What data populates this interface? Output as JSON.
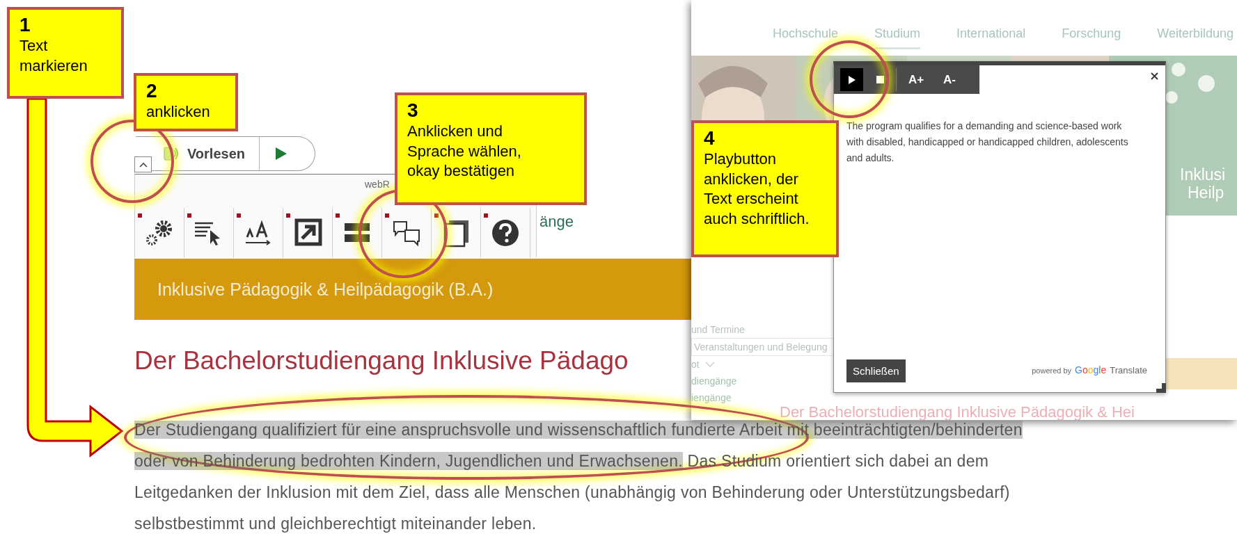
{
  "callouts": [
    {
      "number": "1",
      "text": "Text markieren"
    },
    {
      "number": "2",
      "text": "anklicken"
    },
    {
      "number": "3",
      "text": "Anklicken und Sprache wählen, okay bestätigen"
    },
    {
      "number": "4",
      "text": "Playbutton anklicken, der Text erscheint auch schriftlich."
    }
  ],
  "reader_bar": {
    "label": "Vorlesen"
  },
  "tool_panel": {
    "title": "webR",
    "trailing_text": "änge"
  },
  "course_banner": {
    "title": "Inklusive Pädagogik & Heilpädagogik (B.A.)"
  },
  "heading": "Der Bachelorstudiengang Inklusive Pädago",
  "paragraph": {
    "selected_text": "Der Studiengang qualifiziert für eine anspruchsvolle und wissenschaftlich fundierte Arbeit mit beeinträchtigten/behinderten oder von Behinderung bedrohten Kindern, Jugendlichen und Erwachsenen.",
    "text": " Das Studium orientiert sich dabei an dem Leitgedanken der Inklusion mit dem Ziel, dass alle Menschen (unabhängig von Behinderung oder Unterstützungsbedarf) selbstbestimmt und gleichberechtigt miteinander leben."
  },
  "second_screenshot": {
    "nav": [
      {
        "label": "Hochschule",
        "selected": false
      },
      {
        "label": "Studium",
        "selected": true
      },
      {
        "label": "International",
        "selected": false
      },
      {
        "label": "Forschung",
        "selected": false
      },
      {
        "label": "Weiterbildung",
        "selected": false
      }
    ],
    "banner_text": [
      "Inklusi",
      "Heilp"
    ],
    "sidebar": [
      "und Termine",
      "Veranstaltungen und Belegung",
      "ot",
      "diengänge",
      "iengänge"
    ],
    "heading": "Der Bachelorstudiengang Inklusive Pädagogik & Hei",
    "dialog": {
      "tools": [
        {
          "kind": "play",
          "selected": true
        },
        {
          "kind": "stop",
          "selected": false
        },
        {
          "kind": "text",
          "label": "A+",
          "selected": false
        },
        {
          "kind": "text",
          "label": "A-",
          "selected": false
        }
      ],
      "text": "The program qualifies for a demanding and science-based work with disabled, handicapped or handicapped children, adolescents and adults.",
      "close_button": "Schließen",
      "credit": "powered by",
      "brand": "Google",
      "service": "Translate"
    }
  }
}
